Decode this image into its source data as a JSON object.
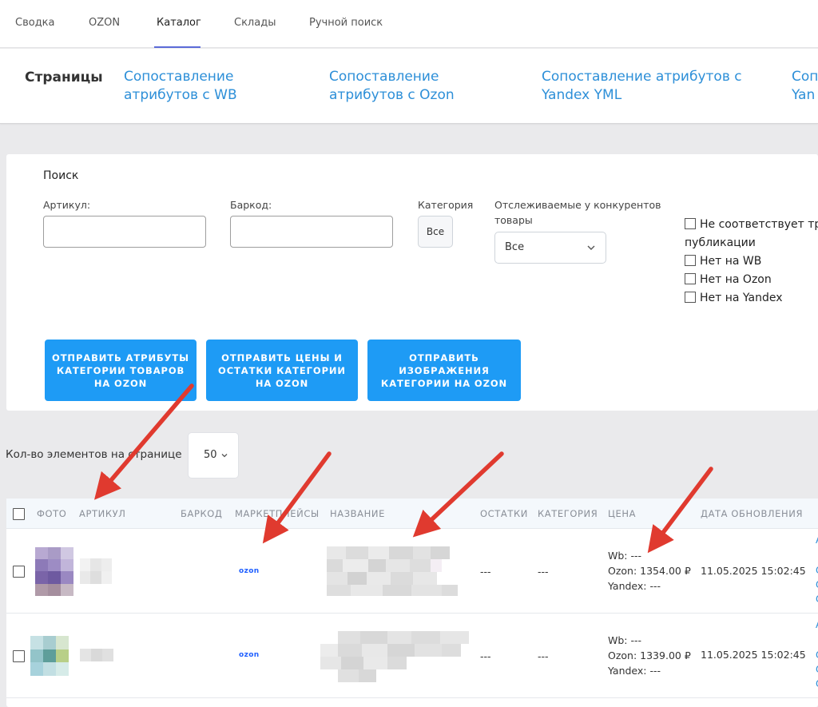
{
  "topnav": {
    "tabs": [
      "Сводка",
      "OZON",
      "Каталог",
      "Склады",
      "Ручной поиск"
    ],
    "active": "Каталог"
  },
  "pages": {
    "title": "Страницы",
    "links": [
      "Сопоставление атрибутов с WB",
      "Сопоставление атрибутов с Ozon",
      "Сопоставление атрибутов с Yandex YML",
      "Сопоставление Yandex"
    ],
    "links_visible": [
      "Сопоставление\nатрибутов с WB",
      "Сопоставление\nатрибутов с Ozon",
      "Сопоставление атрибутов с\nYandex YML",
      "Соп\nYan"
    ]
  },
  "search": {
    "title": "Поиск",
    "article_label": "Артикул:",
    "article_value": "",
    "barcode_label": "Баркод:",
    "barcode_value": "",
    "category_label": "Категория",
    "category_value": "Все",
    "tracked_label": "Отслеживаемые у конкурентов товары",
    "tracked_value": "Все",
    "checkboxes": [
      "Не соответствует тре",
      "публикации",
      "Нет на WB",
      "Нет на Ozon",
      "Нет на Yandex"
    ]
  },
  "buttons": [
    "ОТПРАВИТЬ АТРИБУТЫ КАТЕГОРИИ ТОВАРОВ НА OZON",
    "ОТПРАВИТЬ ЦЕНЫ И ОСТАТКИ КАТЕГОРИИ НА OZON",
    "ОТПРАВИТЬ ИЗОБРАЖЕНИЯ КАТЕГОРИИ НА OZON"
  ],
  "per_page": {
    "label": "Кол-во элементов на странице",
    "value": "50"
  },
  "table": {
    "headers": [
      "ФОТО",
      "АРТИКУЛ",
      "БАРКОД",
      "МАРКЕТПЛЕЙСЫ",
      "НАЗВАНИЕ",
      "ОСТАТКИ",
      "КАТЕГОРИЯ",
      "ЦЕНА",
      "ДАТА ОБНОВЛЕНИЯ"
    ],
    "rows": [
      {
        "marketplace": "OZON",
        "stock": "---",
        "category": "---",
        "price_wb": "Wb: ---",
        "price_ozon": "Ozon: 1354.00 ₽",
        "price_yandex": "Yandex: ---",
        "updated": "11.05.2025 15:02:45"
      },
      {
        "marketplace": "OZON",
        "stock": "---",
        "category": "---",
        "price_wb": "Wb: ---",
        "price_ozon": "Ozon: 1339.00 ₽",
        "price_yandex": "Yandex: ---",
        "updated": "11.05.2025 15:02:45"
      }
    ]
  },
  "colors": {
    "accent": "#1e9bf5",
    "link": "#2d8fd8",
    "arrow": "#e03a2f",
    "ozon": "#1f5fff"
  }
}
